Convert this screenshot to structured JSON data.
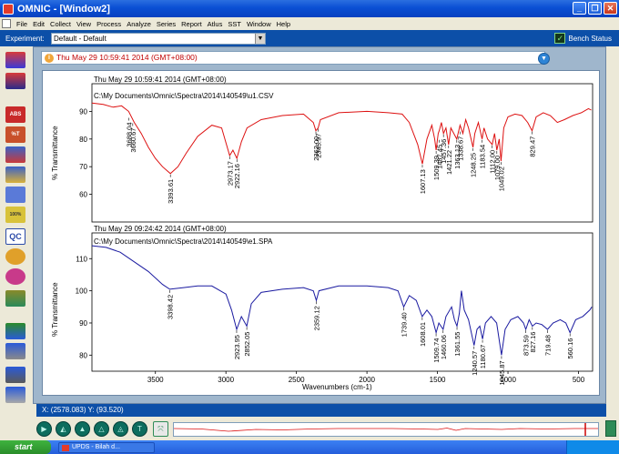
{
  "window": {
    "title": "OMNIC - [Window2]",
    "buttons": {
      "minimize": "_",
      "restore": "❐",
      "close": "✕"
    }
  },
  "menu": [
    "File",
    "Edit",
    "Collect",
    "View",
    "Process",
    "Analyze",
    "Series",
    "Report",
    "Atlus",
    "SST",
    "Window",
    "Help"
  ],
  "experiment": {
    "label": "Experiment:",
    "value": "Default - Default",
    "bench_status": "Bench Status"
  },
  "title_field": {
    "value": "Thu May 29 10:59:41 2014 (GMT+08:00)"
  },
  "left_toolbar": [
    {
      "icon": "collect-sample-icon"
    },
    {
      "icon": "collect-background-icon"
    },
    {
      "icon": "abs-icon",
      "text": "ABS"
    },
    {
      "icon": "percent-t-icon",
      "text": "%T"
    },
    {
      "icon": "baseline-icon"
    },
    {
      "icon": "library-icon"
    },
    {
      "icon": "search-icon"
    },
    {
      "icon": "note-icon",
      "text": "100%"
    },
    {
      "icon": "qc-icon",
      "text": "QC"
    },
    {
      "icon": "quant-icon"
    },
    {
      "icon": "compare-icon"
    },
    {
      "icon": "peak-icon"
    },
    {
      "icon": "print-icon"
    },
    {
      "icon": "report-icon"
    },
    {
      "icon": "display-icon"
    },
    {
      "icon": "export-icon"
    },
    {
      "icon": "setup-icon"
    }
  ],
  "status": {
    "cursor": "X: (2578.083) Y: (93.520)"
  },
  "taskbar": {
    "start": "start",
    "item": "UPDS - Bilah d..."
  },
  "chart_data": [
    {
      "type": "line",
      "title": "Thu May 29 10:59:41 2014 (GMT+08:00)",
      "subtitle": "C:\\My Documents\\Omnic\\Spectra\\2014\\140549\\u1.CSV",
      "ylabel": "% Transmittance",
      "xlabel": "",
      "x_reversed": true,
      "xlim": [
        3950,
        400
      ],
      "ylim": [
        50,
        100
      ],
      "yticks": [
        60,
        70,
        80,
        90
      ],
      "line_color": "#dd1111",
      "series": [
        {
          "values": [
            [
              3950,
              93
            ],
            [
              3870,
              92.5
            ],
            [
              3800,
              91.5
            ],
            [
              3740,
              92
            ],
            [
              3690,
              90
            ],
            [
              3650,
              86
            ],
            [
              3600,
              82
            ],
            [
              3550,
              77
            ],
            [
              3500,
              73
            ],
            [
              3450,
              70
            ],
            [
              3393.61,
              67.5
            ],
            [
              3340,
              70
            ],
            [
              3280,
              75
            ],
            [
              3200,
              81
            ],
            [
              3100,
              85
            ],
            [
              3030,
              84
            ],
            [
              2973.17,
              74
            ],
            [
              2950,
              76
            ],
            [
              2922.16,
              73
            ],
            [
              2890,
              79
            ],
            [
              2850,
              84
            ],
            [
              2750,
              87
            ],
            [
              2600,
              88.5
            ],
            [
              2450,
              89
            ],
            [
              2380,
              86
            ],
            [
              2362.0,
              83
            ],
            [
              2345.97,
              84
            ],
            [
              2330,
              87
            ],
            [
              2200,
              89.5
            ],
            [
              2000,
              90
            ],
            [
              1850,
              89.5
            ],
            [
              1750,
              89
            ],
            [
              1700,
              86
            ],
            [
              1640,
              78
            ],
            [
              1607.13,
              71
            ],
            [
              1575,
              80
            ],
            [
              1540,
              85
            ],
            [
              1520,
              80
            ],
            [
              1509.39,
              76
            ],
            [
              1495,
              82
            ],
            [
              1487.45,
              83
            ],
            [
              1472,
              86
            ],
            [
              1457.36,
              82
            ],
            [
              1440,
              84
            ],
            [
              1421.22,
              78
            ],
            [
              1405,
              84
            ],
            [
              1363.13,
              80
            ],
            [
              1340,
              85
            ],
            [
              1320,
              82
            ],
            [
              1300,
              87
            ],
            [
              1280,
              84
            ],
            [
              1248.25,
              77
            ],
            [
              1235,
              82
            ],
            [
              1210,
              86
            ],
            [
              1183.54,
              80
            ],
            [
              1170,
              84
            ],
            [
              1145,
              80
            ],
            [
              1112.0,
              78
            ],
            [
              1095,
              82
            ],
            [
              1079.0,
              76
            ],
            [
              1062,
              80
            ],
            [
              1049.02,
              72
            ],
            [
              1030,
              84
            ],
            [
              1000,
              88
            ],
            [
              950,
              89
            ],
            [
              900,
              88.5
            ],
            [
              860,
              86
            ],
            [
              829.47,
              83
            ],
            [
              800,
              88
            ],
            [
              750,
              89.5
            ],
            [
              700,
              88.5
            ],
            [
              650,
              86
            ],
            [
              600,
              87
            ],
            [
              540,
              88.5
            ],
            [
              480,
              89.5
            ],
            [
              430,
              91
            ],
            [
              410,
              90.5
            ]
          ]
        }
      ],
      "annotations": [
        {
          "x": 3688.04,
          "y": 88,
          "label": "3688.04"
        },
        {
          "x": 3660.67,
          "y": 86,
          "label": "3660.67"
        },
        {
          "x": 3393.61,
          "y": 67.5,
          "label": "3393.61"
        },
        {
          "x": 2973.17,
          "y": 74,
          "label": "2973.17"
        },
        {
          "x": 2922.16,
          "y": 73,
          "label": "2922.16"
        },
        {
          "x": 2362.0,
          "y": 83,
          "label": "2362.00"
        },
        {
          "x": 2345.97,
          "y": 84,
          "label": "2345.97"
        },
        {
          "x": 1607.13,
          "y": 71,
          "label": "1607.13"
        },
        {
          "x": 1509.39,
          "y": 76,
          "label": "1509.39"
        },
        {
          "x": 1487.45,
          "y": 80,
          "label": "1487.45"
        },
        {
          "x": 1457.36,
          "y": 82,
          "label": "1457.36"
        },
        {
          "x": 1421.22,
          "y": 78,
          "label": "1421.22"
        },
        {
          "x": 1363.13,
          "y": 80,
          "label": "1363.13"
        },
        {
          "x": 1338.67,
          "y": 83,
          "label": "1338.67"
        },
        {
          "x": 1248.25,
          "y": 77,
          "label": "1248.25"
        },
        {
          "x": 1183.54,
          "y": 80,
          "label": "1183.54"
        },
        {
          "x": 1112.0,
          "y": 78,
          "label": "1112.00"
        },
        {
          "x": 1079.0,
          "y": 76,
          "label": "1079.00"
        },
        {
          "x": 1049.02,
          "y": 72,
          "label": "1049.02"
        },
        {
          "x": 829.47,
          "y": 83,
          "label": "829.47"
        }
      ]
    },
    {
      "type": "line",
      "title": "Thu May 29 09:24:42 2014 (GMT+08:00)",
      "subtitle": "C:\\My Documents\\Omnic\\Spectra\\2014\\140549\\e1.SPA",
      "ylabel": "% Transmittance",
      "xlabel": "Wavenumbers (cm-1)",
      "x_reversed": true,
      "xlim": [
        3950,
        400
      ],
      "ylim": [
        75,
        118
      ],
      "yticks": [
        80,
        90,
        100,
        110
      ],
      "xticks": [
        3500,
        3000,
        2500,
        2000,
        1500,
        1000,
        500
      ],
      "line_color": "#1a1aa0",
      "series": [
        {
          "values": [
            [
              3950,
              114
            ],
            [
              3850,
              113.5
            ],
            [
              3750,
              112
            ],
            [
              3650,
              109
            ],
            [
              3550,
              106
            ],
            [
              3450,
              102
            ],
            [
              3398.42,
              100.5
            ],
            [
              3300,
              101
            ],
            [
              3200,
              101.5
            ],
            [
              3100,
              101.5
            ],
            [
              3000,
              99
            ],
            [
              2960,
              94
            ],
            [
              2923.95,
              88
            ],
            [
              2890,
              92
            ],
            [
              2852.05,
              89
            ],
            [
              2820,
              96
            ],
            [
              2750,
              99.5
            ],
            [
              2600,
              100.5
            ],
            [
              2450,
              101
            ],
            [
              2380,
              100
            ],
            [
              2359.12,
              97
            ],
            [
              2340,
              100
            ],
            [
              2200,
              101.5
            ],
            [
              2000,
              101.5
            ],
            [
              1850,
              101
            ],
            [
              1780,
              100
            ],
            [
              1739.4,
              95
            ],
            [
              1700,
              98.5
            ],
            [
              1650,
              97
            ],
            [
              1608.01,
              92
            ],
            [
              1575,
              94
            ],
            [
              1540,
              92
            ],
            [
              1509.74,
              87
            ],
            [
              1490,
              90
            ],
            [
              1460.06,
              88
            ],
            [
              1440,
              92
            ],
            [
              1400,
              95
            ],
            [
              1380,
              91
            ],
            [
              1361.55,
              89
            ],
            [
              1345,
              93
            ],
            [
              1330,
              100
            ],
            [
              1310,
              94
            ],
            [
              1280,
              91
            ],
            [
              1240.57,
              83
            ],
            [
              1220,
              88
            ],
            [
              1200,
              89
            ],
            [
              1180.67,
              85
            ],
            [
              1160,
              90
            ],
            [
              1120,
              92
            ],
            [
              1080,
              90
            ],
            [
              1045.87,
              80
            ],
            [
              1020,
              88
            ],
            [
              980,
              91
            ],
            [
              930,
              92
            ],
            [
              890,
              90
            ],
            [
              873.59,
              88
            ],
            [
              850,
              91
            ],
            [
              827.16,
              89
            ],
            [
              800,
              90
            ],
            [
              760,
              89.5
            ],
            [
              719.48,
              88
            ],
            [
              680,
              90
            ],
            [
              630,
              91
            ],
            [
              590,
              90
            ],
            [
              560.16,
              87
            ],
            [
              520,
              91
            ],
            [
              470,
              92
            ],
            [
              420,
              94
            ],
            [
              405,
              95
            ]
          ]
        }
      ],
      "annotations": [
        {
          "x": 3398.42,
          "y": 100.5,
          "label": "3398.42"
        },
        {
          "x": 2923.95,
          "y": 88,
          "label": "2923.95"
        },
        {
          "x": 2852.05,
          "y": 89,
          "label": "2852.05"
        },
        {
          "x": 2359.12,
          "y": 97,
          "label": "2359.12"
        },
        {
          "x": 1739.4,
          "y": 95,
          "label": "1739.40"
        },
        {
          "x": 1608.01,
          "y": 92,
          "label": "1608.01"
        },
        {
          "x": 1509.74,
          "y": 87,
          "label": "1509.74"
        },
        {
          "x": 1460.06,
          "y": 88,
          "label": "1460.06"
        },
        {
          "x": 1361.55,
          "y": 89,
          "label": "1361.55"
        },
        {
          "x": 1240.57,
          "y": 83,
          "label": "1240.57"
        },
        {
          "x": 1180.67,
          "y": 85,
          "label": "1180.67"
        },
        {
          "x": 1045.87,
          "y": 80,
          "label": "1045.87"
        },
        {
          "x": 873.59,
          "y": 88,
          "label": "873.59"
        },
        {
          "x": 827.16,
          "y": 89,
          "label": "827.16"
        },
        {
          "x": 719.48,
          "y": 88,
          "label": "719.48"
        },
        {
          "x": 560.16,
          "y": 87,
          "label": "560.16"
        }
      ]
    }
  ]
}
